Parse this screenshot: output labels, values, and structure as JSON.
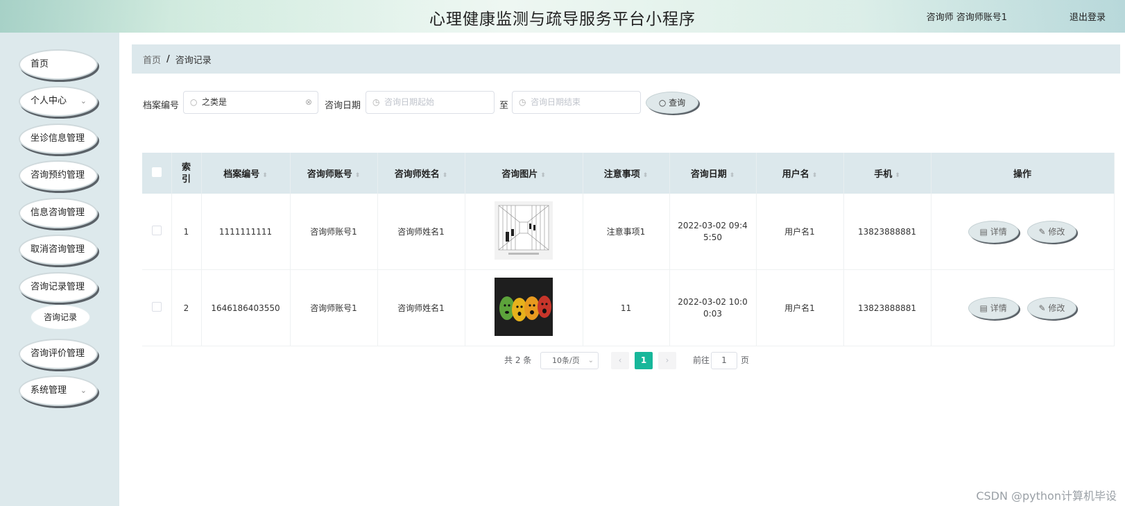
{
  "header": {
    "title": "心理健康监测与疏导服务平台小程序",
    "user": "咨询师  咨询师账号1",
    "logout": "退出登录"
  },
  "sidebar": {
    "items": [
      {
        "label": "首页"
      },
      {
        "label": "个人中心",
        "chevron": "⌄"
      },
      {
        "label": "坐诊信息管理"
      },
      {
        "label": "咨询预约管理"
      },
      {
        "label": "信息咨询管理"
      },
      {
        "label": "取消咨询管理"
      },
      {
        "label": "咨询记录管理"
      },
      {
        "label": "咨询评价管理"
      },
      {
        "label": "系统管理",
        "chevron": "⌄"
      }
    ],
    "subitem": "咨询记录"
  },
  "breadcrumb": {
    "home": "首页",
    "sep": "/",
    "current": "咨询记录"
  },
  "search": {
    "file_label": "档案编号",
    "file_value": "之类是",
    "date_label": "咨询日期",
    "date_start_placeholder": "咨询日期起始",
    "to": "至",
    "date_end_placeholder": "咨询日期结束",
    "button": "查询"
  },
  "table": {
    "headers": [
      "索引",
      "档案编号",
      "咨询师账号",
      "咨询师姓名",
      "咨询图片",
      "注意事项",
      "咨询日期",
      "用户名",
      "手机",
      "操作"
    ],
    "rows": [
      {
        "index": "1",
        "file": "1111111111",
        "account": "咨询师账号1",
        "name": "咨询师姓名1",
        "notes": "注意事项1",
        "date": "2022-03-02 09:45:50",
        "user": "用户名1",
        "phone": "13823888881"
      },
      {
        "index": "2",
        "file": "1646186403550",
        "account": "咨询师账号1",
        "name": "咨询师姓名1",
        "notes": "11",
        "date": "2022-03-02 10:00:03",
        "user": "用户名1",
        "phone": "13823888881"
      }
    ],
    "detail_label": "详情",
    "edit_label": "修改"
  },
  "pagination": {
    "total": "共 2 条",
    "page_size": "10条/页",
    "current": "1",
    "goto_label": "前往",
    "goto_value": "1",
    "goto_suffix": "页"
  },
  "watermark": "CSDN @python计算机毕设",
  "colors": {
    "accent": "#17b79a",
    "sidebar_bg": "#dde9ec",
    "header_row": "#dce8ec"
  }
}
